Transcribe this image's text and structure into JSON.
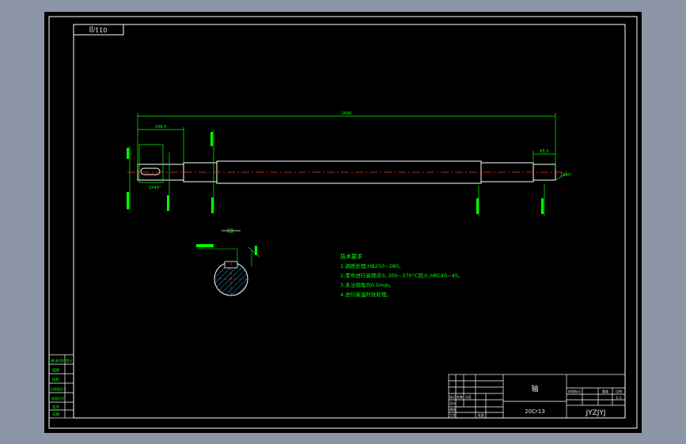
{
  "corner_code": "011/JJ",
  "dimensions": {
    "overall_length": "1680",
    "left_step_length": "108.4",
    "end_chamfer_right": "2X45°",
    "end_chamfer_left": "2X45°",
    "right_step_length": "65.5"
  },
  "tech_requirements": {
    "title": "技术要求",
    "items": [
      "1.调质处理,HB250~280。",
      "2.零件进行高频淬火,300~370°C回火,HRC40~45。",
      "3.未注倒角为0.5mm。",
      "4.进行高温时效处理。"
    ]
  },
  "title_block": {
    "part_name": "轴",
    "material": "20Cr13",
    "drawing_code": "JYZJYJ",
    "scale": "1:1",
    "headers": [
      "阶段标记",
      "重量",
      "比例"
    ],
    "signers": [
      "标记",
      "处数",
      "分区",
      "设计",
      "审核",
      "工艺",
      "批准"
    ]
  },
  "side_table": {
    "rows": [
      "借(通)用件登记",
      "描图",
      "描校",
      "旧底图总号",
      "底图总号",
      "签字",
      "日期"
    ]
  }
}
